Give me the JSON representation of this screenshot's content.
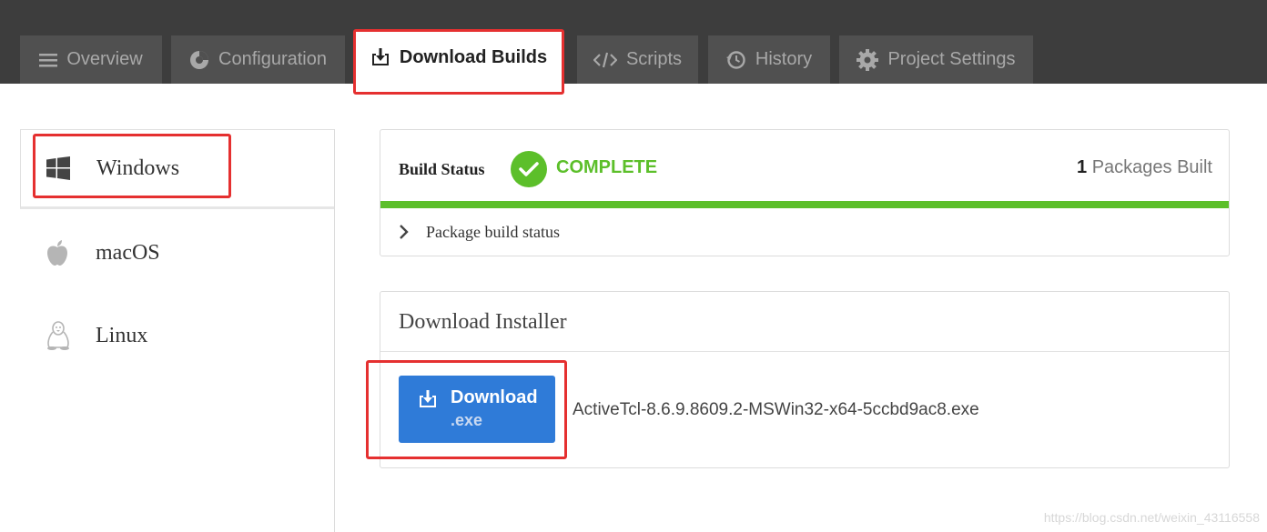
{
  "tabs": [
    {
      "label": "Overview",
      "icon": "menu-lines-icon"
    },
    {
      "label": "Configuration",
      "icon": "palette-icon"
    },
    {
      "label": "Download Builds",
      "icon": "download-tray-icon",
      "active": true
    },
    {
      "label": "Scripts",
      "icon": "code-icon"
    },
    {
      "label": "History",
      "icon": "history-clock-icon"
    },
    {
      "label": "Project Settings",
      "icon": "gear-icon"
    }
  ],
  "platforms": [
    {
      "label": "Windows",
      "icon": "windows-logo-icon",
      "active": true
    },
    {
      "label": "macOS",
      "icon": "apple-logo-icon"
    },
    {
      "label": "Linux",
      "icon": "linux-penguin-icon"
    }
  ],
  "build": {
    "title": "Build Status",
    "state": "COMPLETE",
    "packages_count": "1",
    "packages_label": " Packages Built",
    "package_status_label": "Package build status",
    "status_color": "#5cbf2a"
  },
  "installer": {
    "title": "Download Installer",
    "button_label": "Download",
    "button_ext": ".exe",
    "filename": "ActiveTcl-8.6.9.8609.2-MSWin32-x64-5ccbd9ac8.exe",
    "button_color": "#2f7bd8"
  },
  "watermark": "https://blog.csdn.net/weixin_43116558",
  "annotation_color": "#e53030"
}
